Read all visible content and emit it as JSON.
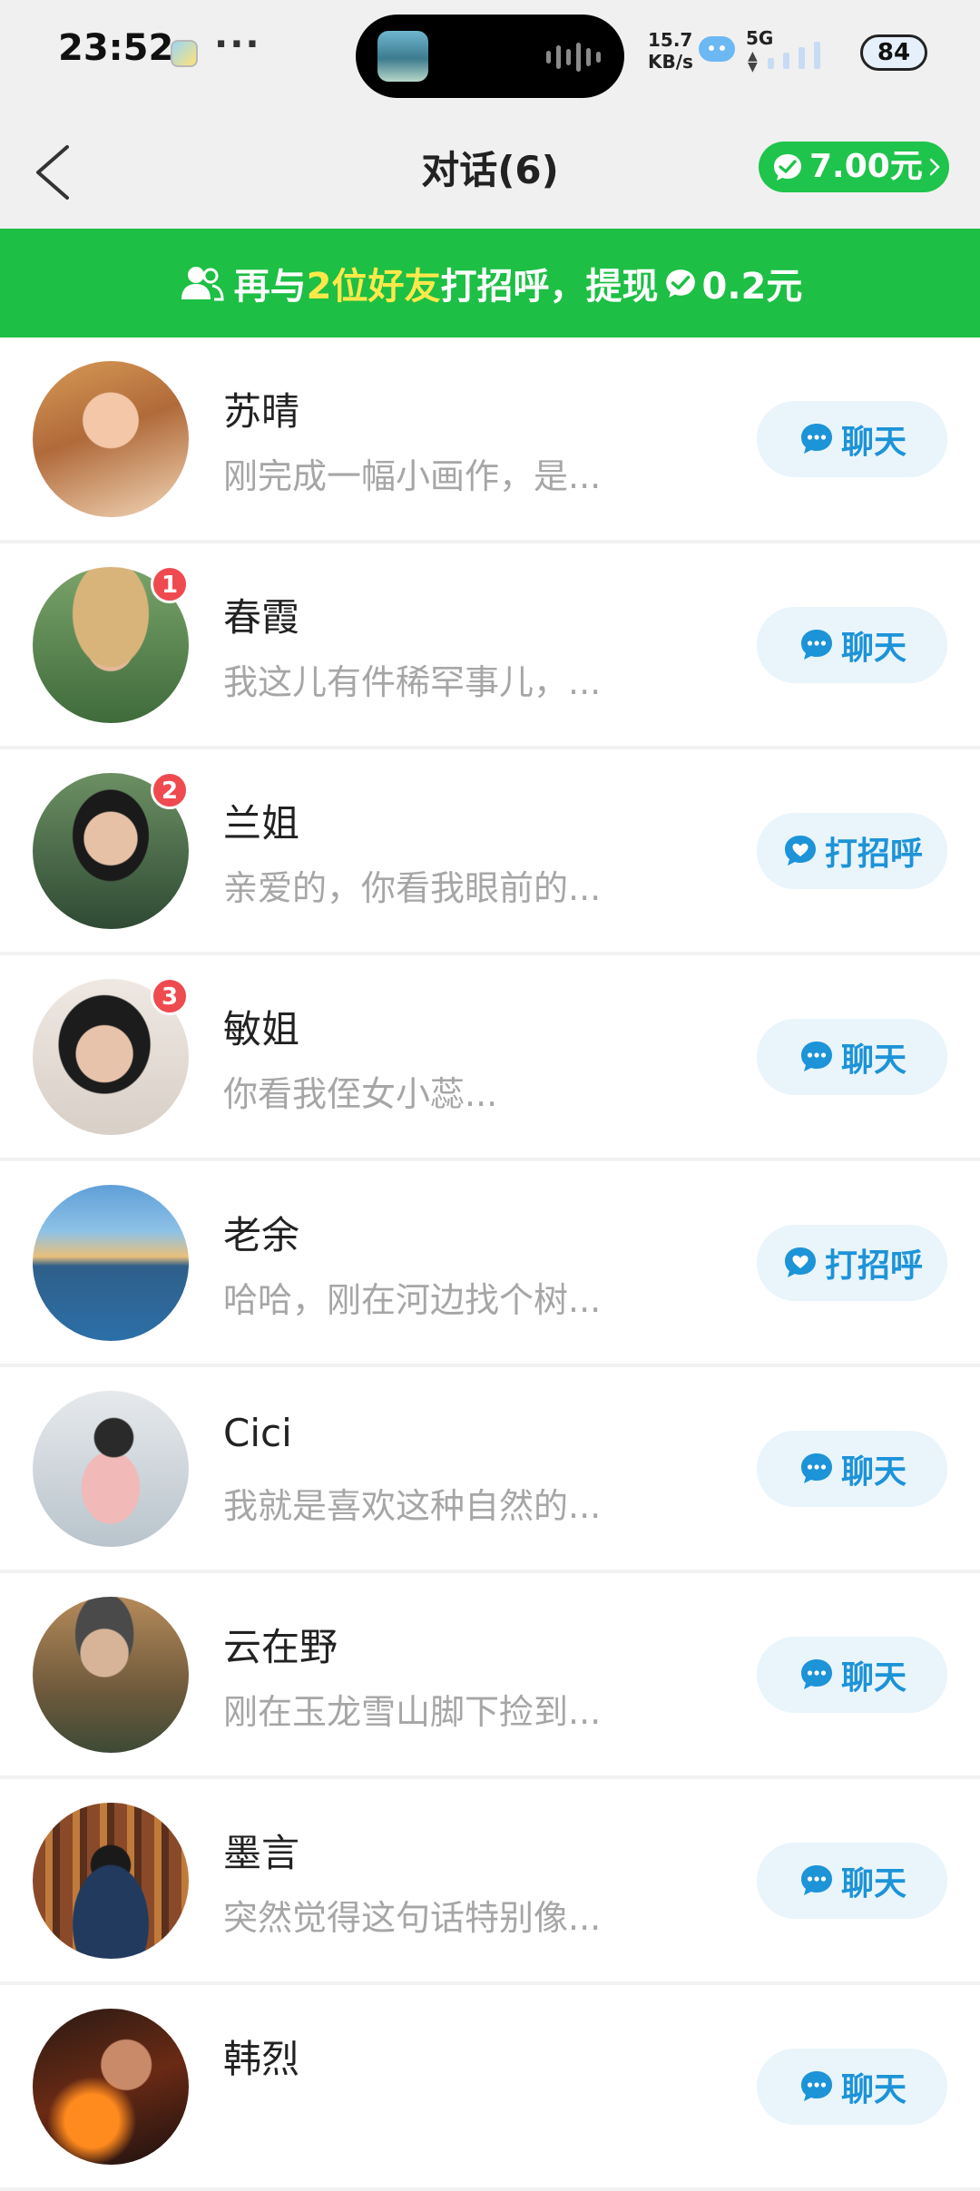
{
  "status_bar": {
    "time": "23:52",
    "more": "···",
    "net_speed_value": "15.7",
    "net_speed_unit": "KB/s",
    "network": "5G",
    "battery": "84"
  },
  "nav": {
    "title": "对话(6)",
    "balance": "7.00元"
  },
  "banner": {
    "prefix": "再与",
    "highlight": "2位好友",
    "middle": "打招呼，提现",
    "amount": "0.2元",
    "highlight_color": "#ffe94a",
    "background": "#1dbf44"
  },
  "conversations": [
    {
      "name": "苏晴",
      "preview": "刚完成一幅小画作，是...",
      "action": "聊天",
      "action_icon": "chat-bubble-icon",
      "badge": ""
    },
    {
      "name": "春霞",
      "preview": "我这儿有件稀罕事儿，...",
      "action": "聊天",
      "action_icon": "chat-bubble-icon",
      "badge": "1"
    },
    {
      "name": "兰姐",
      "preview": "亲爱的，你看我眼前的...",
      "action": "打招呼",
      "action_icon": "heart-bubble-icon",
      "badge": "2"
    },
    {
      "name": "敏姐",
      "preview": "你看我侄女小蕊...",
      "action": "聊天",
      "action_icon": "chat-bubble-icon",
      "badge": "3"
    },
    {
      "name": "老余",
      "preview": "哈哈，刚在河边找个树...",
      "action": "打招呼",
      "action_icon": "heart-bubble-icon",
      "badge": ""
    },
    {
      "name": "Cici",
      "preview": "我就是喜欢这种自然的...",
      "action": "聊天",
      "action_icon": "chat-bubble-icon",
      "badge": ""
    },
    {
      "name": "云在野",
      "preview": "刚在玉龙雪山脚下捡到...",
      "action": "聊天",
      "action_icon": "chat-bubble-icon",
      "badge": ""
    },
    {
      "name": "墨言",
      "preview": "突然觉得这句话特别像...",
      "action": "聊天",
      "action_icon": "chat-bubble-icon",
      "badge": ""
    },
    {
      "name": "韩烈",
      "preview": "",
      "action": "聊天",
      "action_icon": "chat-bubble-icon",
      "badge": ""
    }
  ],
  "colors": {
    "accent_green": "#1ec44b",
    "chat_blue": "#1d93d8",
    "badge_red": "#ee4a4f"
  }
}
